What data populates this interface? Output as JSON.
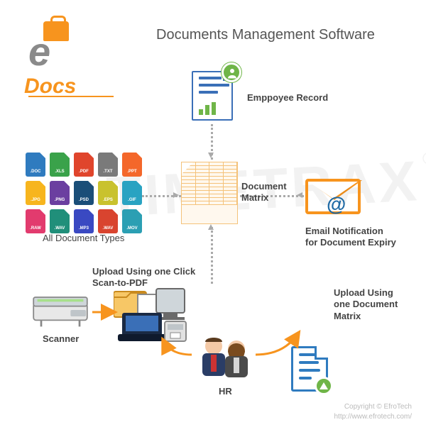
{
  "brand": {
    "name_prefix": "e",
    "name_suffix": "Docs"
  },
  "title": "Documents Management Software",
  "watermark": "TIMETRAX",
  "watermark_mark": "®",
  "credits": {
    "line1": "Copyright © EfroTech",
    "line2": "http://www.efrotech.com/"
  },
  "nodes": {
    "employee_record": "Emppoyee Record",
    "doc_types": "All Document Types",
    "document_matrix": "Document Matrix",
    "email_notify": "Email Notification for Document Expiry",
    "scan_upload": "Upload Using one Click Scan-to-PDF",
    "scanner": "Scanner",
    "hr": "HR",
    "matrix_upload": "Upload Using one Document Matrix"
  },
  "filetypes": [
    {
      "label": ".DOC",
      "color": "#2f7bbf"
    },
    {
      "label": ".XLS",
      "color": "#3aa24a"
    },
    {
      "label": ".PDF",
      "color": "#e0452c"
    },
    {
      "label": ".TXT",
      "color": "#7a7a7a"
    },
    {
      "label": ".PPT",
      "color": "#f4672a"
    },
    {
      "label": ".JPG",
      "color": "#f7b51e"
    },
    {
      "label": ".PNG",
      "color": "#6b3fa0"
    },
    {
      "label": ".PSD",
      "color": "#1a4e78"
    },
    {
      "label": ".EPS",
      "color": "#c9c22e"
    },
    {
      "label": ".GIF",
      "color": "#29a3c2"
    },
    {
      "label": ".RAW",
      "color": "#e23b6e"
    },
    {
      "label": ".WAV",
      "color": "#208f7a"
    },
    {
      "label": ".MP3",
      "color": "#3a49c2"
    },
    {
      "label": ".WAV",
      "color": "#d9442f"
    },
    {
      "label": ".MOV",
      "color": "#2b9fb3"
    }
  ]
}
